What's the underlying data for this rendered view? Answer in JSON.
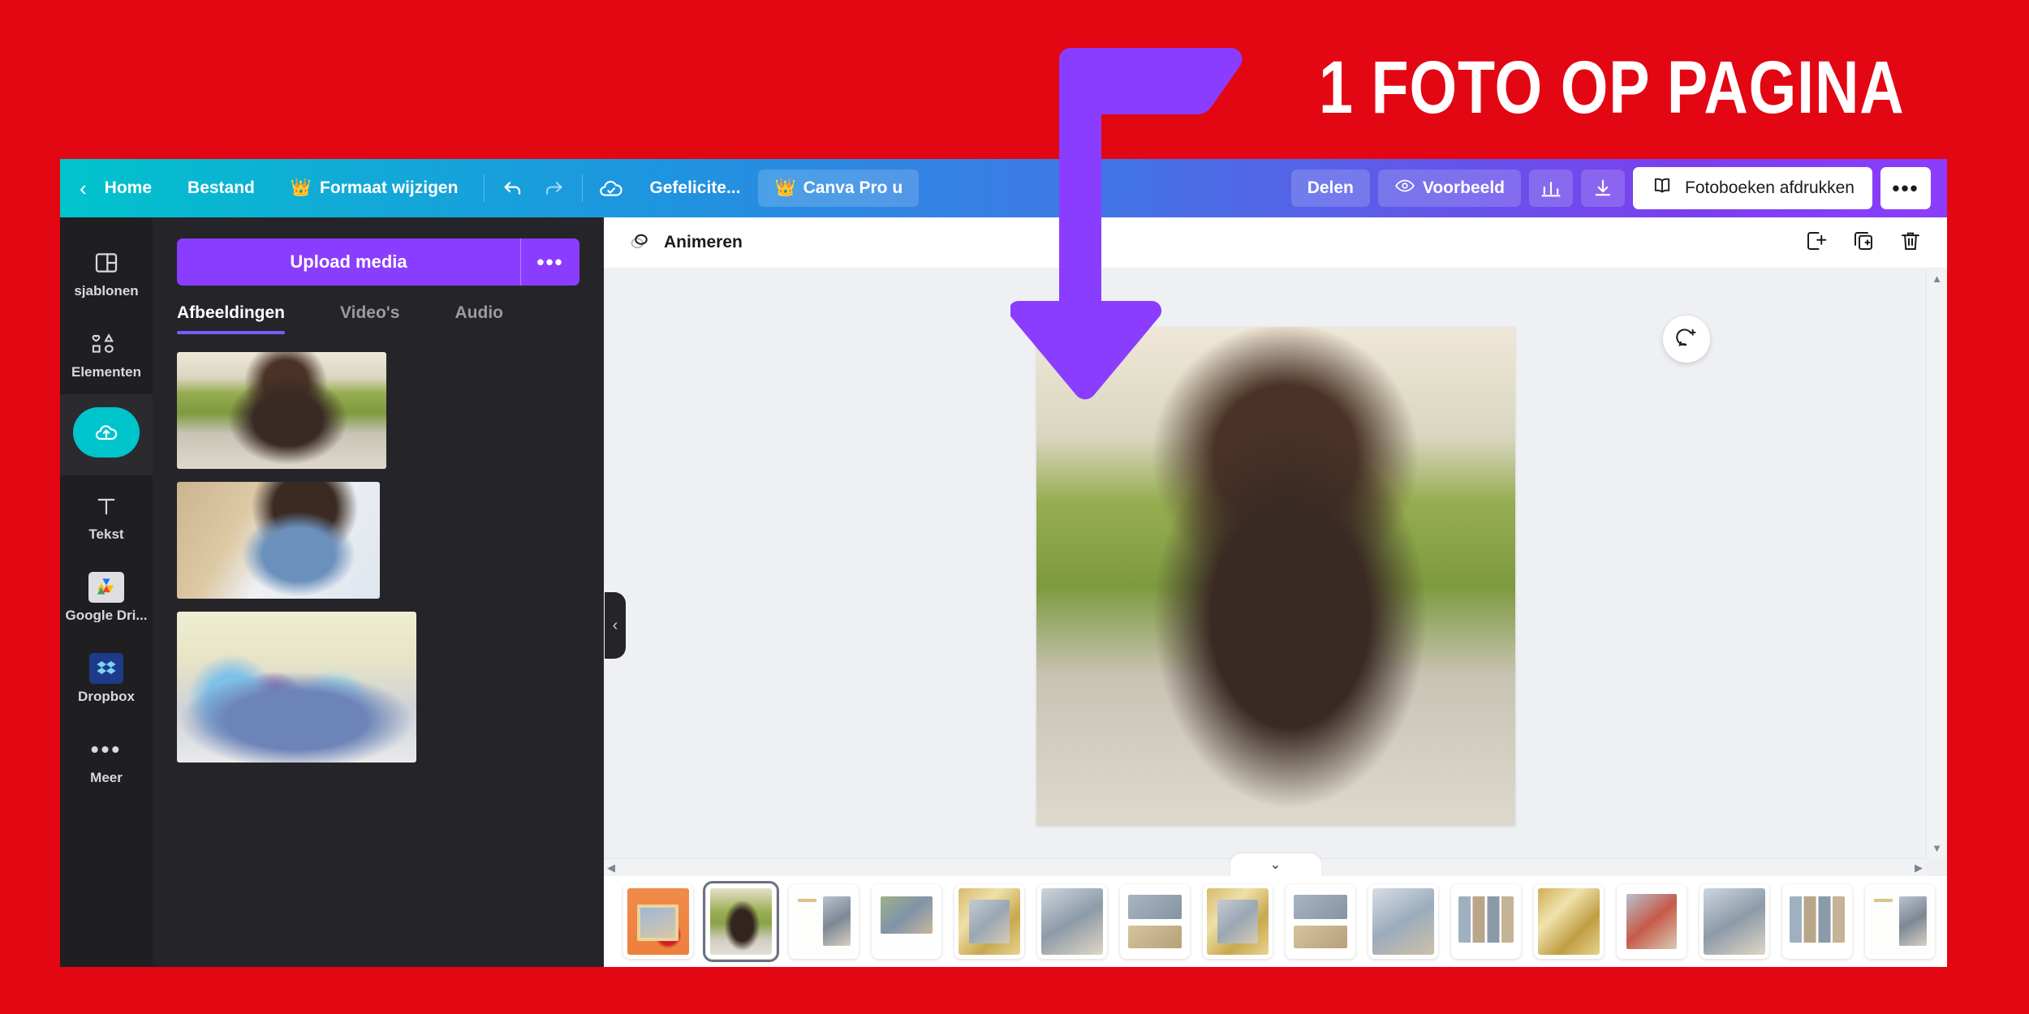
{
  "annotation": {
    "headline": "1 FOTO OP PAGINA",
    "arrow_color": "#8B3DFF",
    "backdrop_color": "#E30613"
  },
  "topbar": {
    "back_icon": "chevron-left-icon",
    "home_label": "Home",
    "file_label": "Bestand",
    "resize_crown_icon": "crown-icon",
    "resize_label": "Formaat wijzigen",
    "undo_icon": "undo-icon",
    "redo_icon": "redo-icon",
    "cloud_saved_icon": "cloud-check-icon",
    "title_label": "Gefelicite...",
    "pro_crown_icon": "crown-icon",
    "pro_label": "Canva Pro u",
    "share_label": "Delen",
    "preview_icon": "eye-icon",
    "preview_label": "Voorbeeld",
    "stats_icon": "bar-chart-icon",
    "download_icon": "download-icon",
    "print_icon": "book-icon",
    "print_label": "Fotoboeken afdrukken",
    "more_label": "•••"
  },
  "rail": {
    "items": [
      {
        "label": "sjablonen",
        "icon": "layout-template-icon",
        "active": false
      },
      {
        "label": "Elementen",
        "icon": "shapes-icon",
        "active": false
      },
      {
        "label": "",
        "icon": "cloud-upload-icon",
        "active": true
      },
      {
        "label": "Tekst",
        "icon": "text-t-icon",
        "active": false
      },
      {
        "label": "Google Dri...",
        "icon": "google-drive-icon",
        "active": false
      },
      {
        "label": "Dropbox",
        "icon": "dropbox-icon",
        "active": false
      },
      {
        "label": "Meer",
        "icon": "more-dots-icon",
        "active": false
      }
    ]
  },
  "panel": {
    "upload_button": "Upload media",
    "upload_more_icon": "more-dots-icon",
    "tabs": [
      {
        "label": "Afbeeldingen",
        "active": true
      },
      {
        "label": "Video's",
        "active": false
      },
      {
        "label": "Audio",
        "active": false
      }
    ],
    "thumbnails": [
      {
        "name": "man-sunglasses-photo"
      },
      {
        "name": "man-phone-photo"
      },
      {
        "name": "teen-group-photo"
      }
    ],
    "collapse_icon": "chevron-left-icon"
  },
  "canvas": {
    "animate_icon": "animate-icon",
    "animate_label": "Animeren",
    "add_page_icon": "add-page-icon",
    "duplicate_page_icon": "duplicate-page-icon",
    "delete_page_icon": "trash-icon",
    "comment_icon": "add-comment-icon",
    "expand_icon": "chevron-down-icon",
    "scroll_up_icon": "caret-up-icon",
    "scroll_down_icon": "caret-down-icon",
    "scroll_left_icon": "caret-left-icon",
    "scroll_right_icon": "caret-right-icon",
    "page_photo": "man-sunglasses-photo"
  },
  "page_strip": {
    "selected_index": 1,
    "pages": [
      {
        "num": "1",
        "style": "t-orange"
      },
      {
        "num": "2",
        "style": "t-hero"
      },
      {
        "num": "3",
        "style": "t-white"
      },
      {
        "num": "4",
        "style": "t-group"
      },
      {
        "num": "5",
        "style": "t-gold"
      },
      {
        "num": "6",
        "style": "t-photo"
      },
      {
        "num": "7",
        "style": "t-coll"
      },
      {
        "num": "8",
        "style": "t-gold"
      },
      {
        "num": "9",
        "style": "t-coll"
      },
      {
        "num": "10",
        "style": "t-couple"
      },
      {
        "num": "11",
        "style": "t-multi"
      },
      {
        "num": "12",
        "style": "t-goldfull"
      },
      {
        "num": "13",
        "style": "t-gift"
      },
      {
        "num": "14",
        "style": "t-photo"
      },
      {
        "num": "15",
        "style": "t-multi"
      },
      {
        "num": "16",
        "style": "t-white"
      }
    ]
  }
}
